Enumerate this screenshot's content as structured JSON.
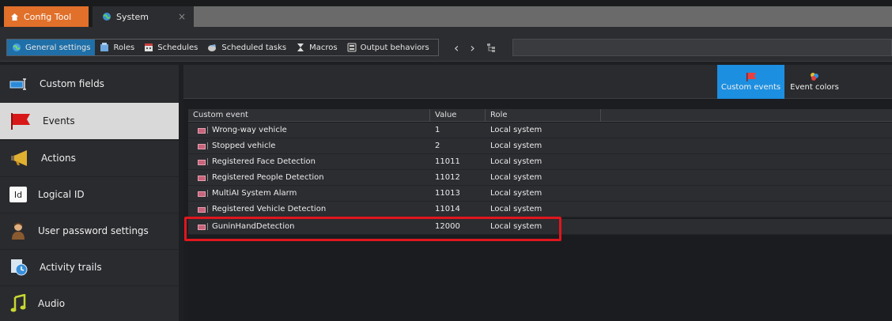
{
  "tabs": {
    "config_tool": "Config Tool",
    "system": "System",
    "close": "×"
  },
  "nav": {
    "items": [
      {
        "label": "General settings",
        "icon": "globe-icon"
      },
      {
        "label": "Roles",
        "icon": "roles-icon"
      },
      {
        "label": "Schedules",
        "icon": "calendar-icon"
      },
      {
        "label": "Scheduled tasks",
        "icon": "scheduled-tasks-icon"
      },
      {
        "label": "Macros",
        "icon": "macro-icon"
      },
      {
        "label": "Output behaviors",
        "icon": "output-icon"
      }
    ],
    "back": "‹",
    "forward": "›"
  },
  "sidebar": {
    "items": [
      {
        "label": "Custom fields",
        "icon": "custom-fields-icon"
      },
      {
        "label": "Events",
        "icon": "flag-icon"
      },
      {
        "label": "Actions",
        "icon": "megaphone-icon"
      },
      {
        "label": "Logical ID",
        "icon": "id-icon",
        "icon_text": "Id"
      },
      {
        "label": "User password settings",
        "icon": "user-icon"
      },
      {
        "label": "Activity trails",
        "icon": "activity-trails-icon"
      },
      {
        "label": "Audio",
        "icon": "music-note-icon"
      }
    ]
  },
  "toolbar": {
    "custom_events": "Custom events",
    "event_colors": "Event colors"
  },
  "table": {
    "headers": [
      "Custom event",
      "Value",
      "Role"
    ],
    "rows": [
      {
        "name": "Wrong-way vehicle",
        "value": "1",
        "role": "Local system"
      },
      {
        "name": "Stopped vehicle",
        "value": "2",
        "role": "Local system"
      },
      {
        "name": "Registered Face Detection",
        "value": "11011",
        "role": "Local system"
      },
      {
        "name": "Registered People Detection",
        "value": "11012",
        "role": "Local system"
      },
      {
        "name": "MultiAI System Alarm",
        "value": "11013",
        "role": "Local system"
      },
      {
        "name": "Registered Vehicle Detection",
        "value": "11014",
        "role": "Local system"
      },
      {
        "name": "GuninHandDetection",
        "value": "12000",
        "role": "Local system"
      }
    ]
  },
  "colors": {
    "accent": "#1d8fe0",
    "config_tab": "#e0702a",
    "highlight": "#e0161d"
  }
}
